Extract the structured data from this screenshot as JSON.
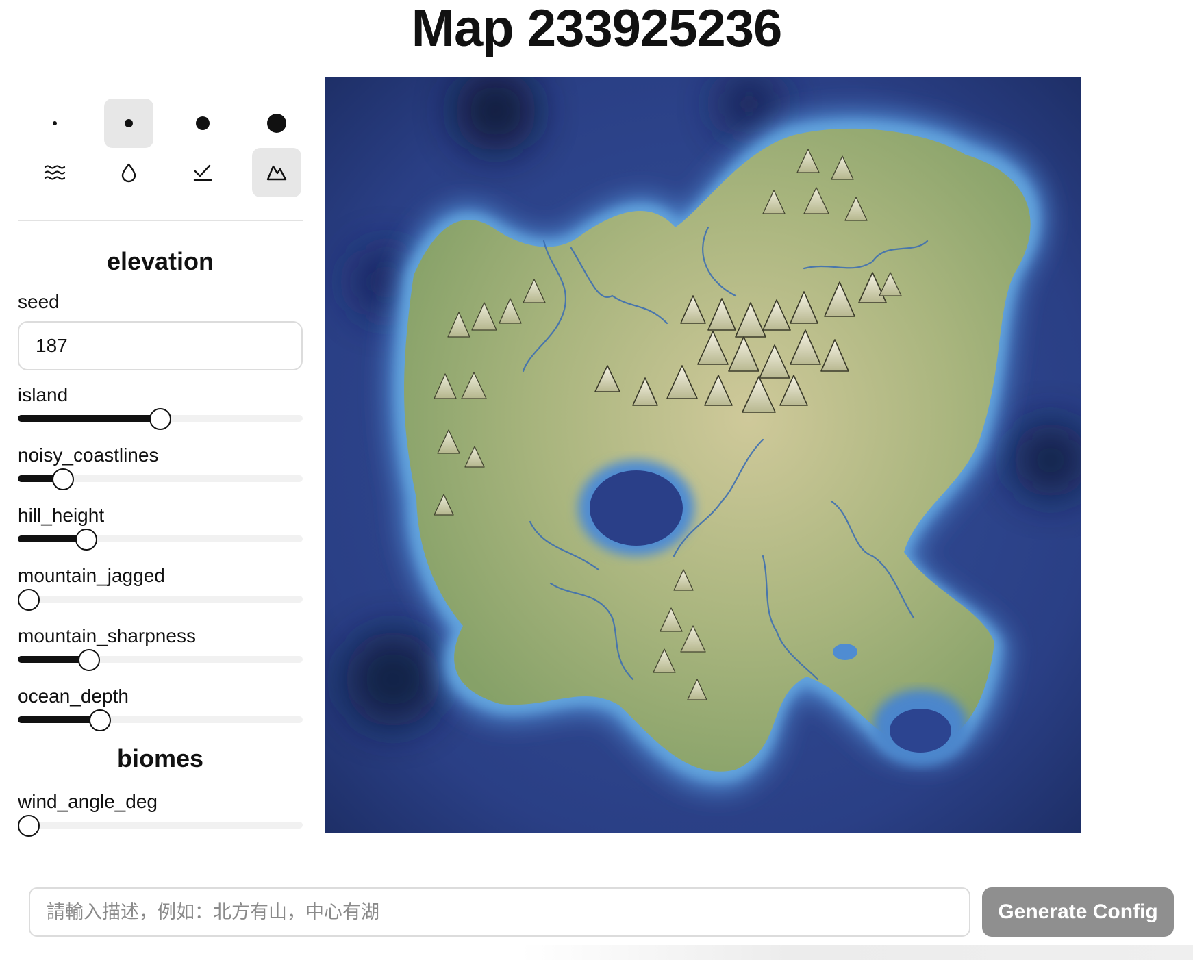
{
  "page": {
    "title": "Map 233925236"
  },
  "tools": {
    "brush_sizes": [
      {
        "name": "brush-size-tiny",
        "active": false
      },
      {
        "name": "brush-size-small",
        "active": true
      },
      {
        "name": "brush-size-medium",
        "active": false
      },
      {
        "name": "brush-size-large",
        "active": false
      }
    ],
    "brush_types": [
      {
        "name": "ocean-tool",
        "icon": "waves-icon",
        "active": false
      },
      {
        "name": "shallow-tool",
        "icon": "water-drop-icon",
        "active": false
      },
      {
        "name": "valley-tool",
        "icon": "checkmark-line-icon",
        "active": false
      },
      {
        "name": "mountain-tool",
        "icon": "mountain-icon",
        "active": true
      }
    ]
  },
  "elevation": {
    "heading": "elevation",
    "seed_label": "seed",
    "seed_value": "187",
    "sliders": [
      {
        "label": "island",
        "value": 0.5
      },
      {
        "label": "noisy_coastlines",
        "value": 0.13
      },
      {
        "label": "hill_height",
        "value": 0.22
      },
      {
        "label": "mountain_jagged",
        "value": 0.0
      },
      {
        "label": "mountain_sharpness",
        "value": 0.23
      },
      {
        "label": "ocean_depth",
        "value": 0.27
      }
    ]
  },
  "biomes": {
    "heading": "biomes",
    "sliders": [
      {
        "label": "wind_angle_deg",
        "value": 0.0
      }
    ]
  },
  "prompt": {
    "placeholder": "請輸入描述，例如：北方有山，中心有湖",
    "value": ""
  },
  "generate_button": {
    "label": "Generate Config"
  },
  "colors": {
    "deep_ocean": "#1f3370",
    "ocean": "#2f4a92",
    "shallow": "#3f77c8",
    "coast": "#5a9fd8",
    "land_low": "#8fa96e",
    "land_mid": "#b5bd8a",
    "peak": "#f3f0e0",
    "river": "#3e6fb0",
    "accent_button": "#8f8f8f"
  }
}
